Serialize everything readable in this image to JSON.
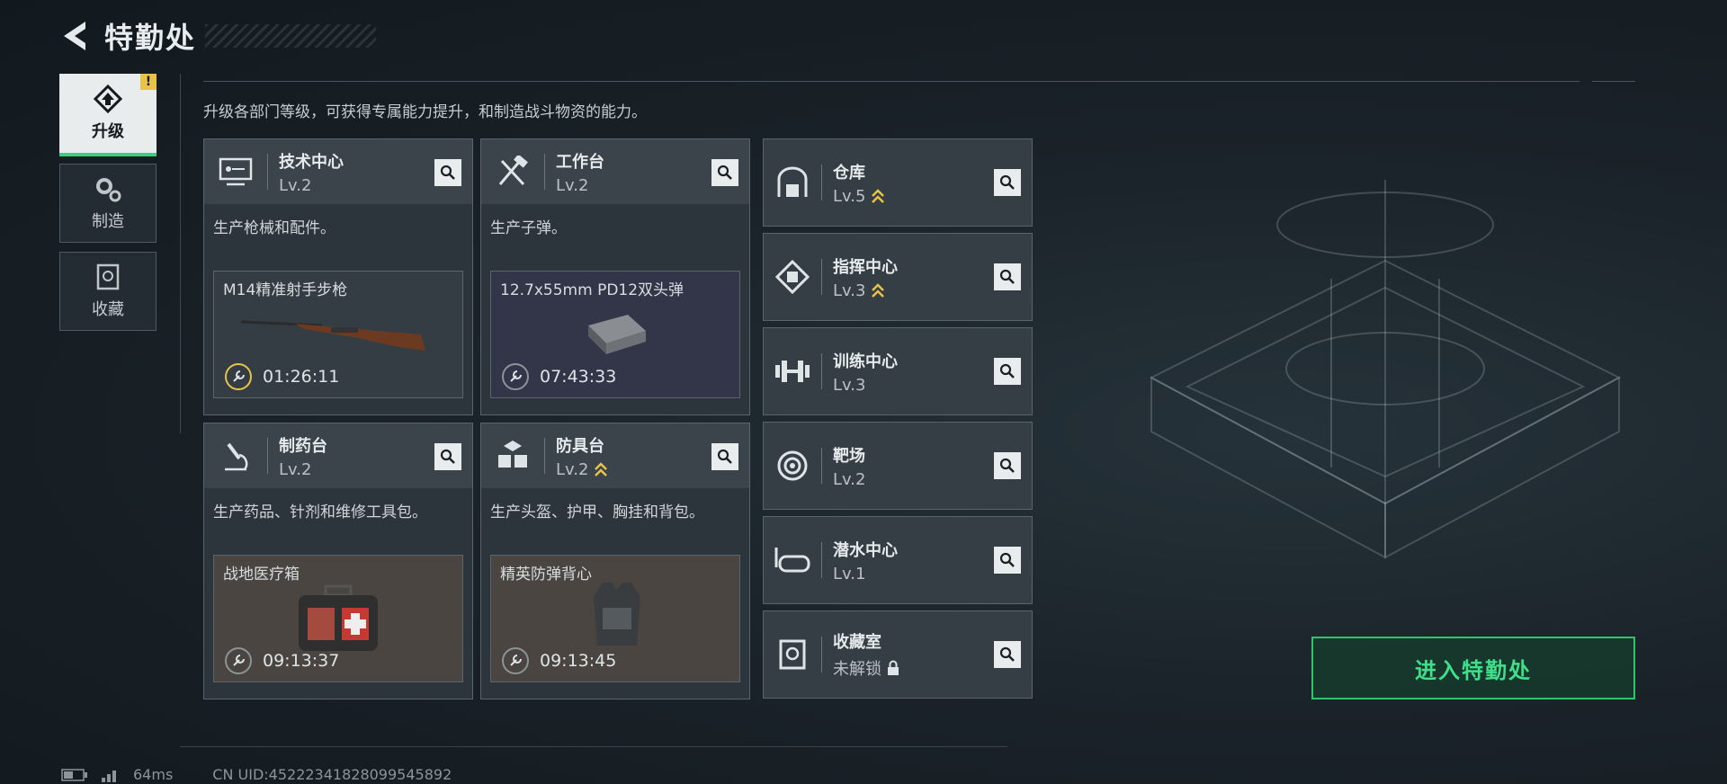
{
  "header": {
    "title": "特勤处"
  },
  "sidebar": {
    "tabs": [
      {
        "label": "升级",
        "active": true,
        "badge": "!"
      },
      {
        "label": "制造",
        "active": false
      },
      {
        "label": "收藏",
        "active": false
      }
    ]
  },
  "intro": "升级各部门等级，可获得专属能力提升，和制造战斗物资的能力。",
  "cards": [
    {
      "name": "技术中心",
      "level": "Lv.2",
      "desc": "生产枪械和配件。",
      "product": "M14精准射手步枪",
      "timer": "01:26:11",
      "upgradable": false
    },
    {
      "name": "工作台",
      "level": "Lv.2",
      "desc": "生产子弹。",
      "product": "12.7x55mm PD12双头弹",
      "timer": "07:43:33",
      "upgradable": false
    },
    {
      "name": "制药台",
      "level": "Lv.2",
      "desc": "生产药品、针剂和维修工具包。",
      "product": "战地医疗箱",
      "timer": "09:13:37",
      "upgradable": false
    },
    {
      "name": "防具台",
      "level": "Lv.2",
      "desc": "生产头盔、护甲、胸挂和背包。",
      "product": "精英防弹背心",
      "timer": "09:13:45",
      "upgradable": true
    }
  ],
  "facilities": [
    {
      "name": "仓库",
      "level": "Lv.5",
      "upgradable": true
    },
    {
      "name": "指挥中心",
      "level": "Lv.3",
      "upgradable": true
    },
    {
      "name": "训练中心",
      "level": "Lv.3",
      "upgradable": false
    },
    {
      "name": "靶场",
      "level": "Lv.2",
      "upgradable": false
    },
    {
      "name": "潜水中心",
      "level": "Lv.1",
      "upgradable": false
    },
    {
      "name": "收藏室",
      "level": "未解锁",
      "locked": true
    }
  ],
  "enter_button": "进入特勤处",
  "status": {
    "ping": "64ms",
    "uid": "CN UID:452223418280995458​92"
  },
  "colors": {
    "accent": "#39d27a",
    "upgrade": "#e7c34a"
  }
}
